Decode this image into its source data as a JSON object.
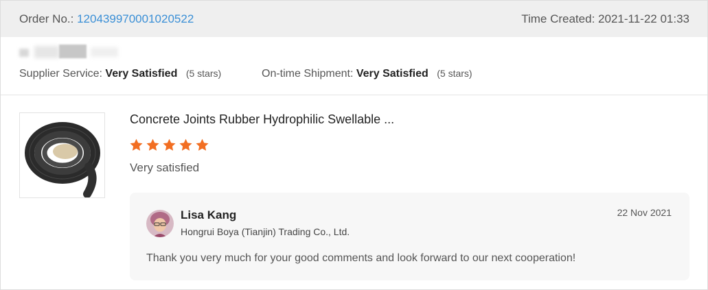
{
  "header": {
    "order_label": "Order No.:",
    "order_number": "120439970001020522",
    "time_created_label": "Time Created:",
    "time_created_value": "2021-11-22 01:33"
  },
  "buyer": {
    "blurred_text": "nc"
  },
  "ratings": {
    "supplier_service_label": "Supplier Service:",
    "supplier_service_value": "Very Satisfied",
    "supplier_service_stars": "(5 stars)",
    "shipment_label": "On-time Shipment:",
    "shipment_value": "Very Satisfied",
    "shipment_stars": "(5 stars)"
  },
  "product": {
    "title": "Concrete Joints Rubber Hydrophilic Swellable ...",
    "star_rating": 5,
    "star_color": "#f26e22",
    "review_text": "Very satisfied"
  },
  "reply": {
    "name": "Lisa Kang",
    "company": "Hongrui Boya (Tianjin) Trading Co., Ltd.",
    "date": "22 Nov 2021",
    "message": "Thank you very much for your good comments and look forward to our next cooperation!"
  },
  "colors": {
    "link": "#3a8fd6",
    "header_bg": "#efefef",
    "reply_bg": "#f7f7f7"
  }
}
